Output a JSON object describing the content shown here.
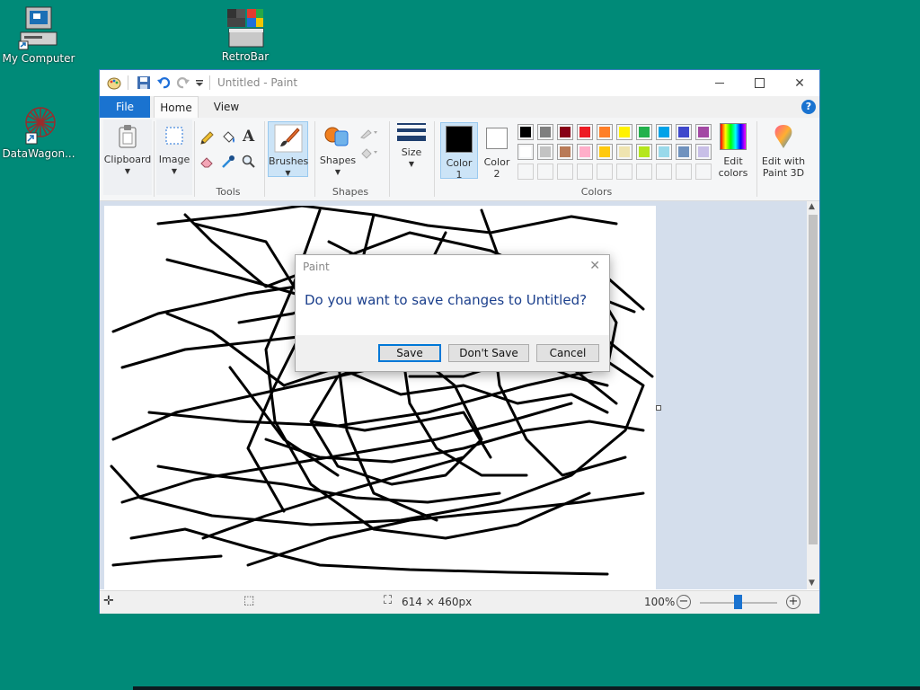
{
  "desktop": {
    "icons": [
      {
        "label": "My Computer"
      },
      {
        "label": "RetroBar"
      },
      {
        "label": "DataWagon..."
      }
    ]
  },
  "window": {
    "title": "Untitled - Paint",
    "tabs": {
      "file": "File",
      "home": "Home",
      "view": "View"
    },
    "help": "?",
    "ribbon": {
      "clipboard": "Clipboard",
      "image": "Image",
      "tools_label": "Tools",
      "brushes": "Brushes",
      "shapes": "Shapes",
      "shapes_label": "Shapes",
      "size": "Size",
      "color1_line1": "Color",
      "color1_line2": "1",
      "color2_line1": "Color",
      "color2_line2": "2",
      "colors_label": "Colors",
      "edit_colors_line1": "Edit",
      "edit_colors_line2": "colors",
      "paint3d_line1": "Edit with",
      "paint3d_line2": "Paint 3D"
    },
    "palette_row1": [
      "#000000",
      "#7f7f7f",
      "#880015",
      "#ed1c24",
      "#ff7f27",
      "#fff200",
      "#22b14c",
      "#00a2e8",
      "#3f48cc",
      "#a349a4"
    ],
    "palette_row2": [
      "#ffffff",
      "#c3c3c3",
      "#b97a57",
      "#ffaec9",
      "#ffc90e",
      "#efe4b0",
      "#b5e61d",
      "#99d9ea",
      "#7092be",
      "#c8bfe7"
    ],
    "status": {
      "dimensions": "614 × 460px",
      "zoom": "100%"
    }
  },
  "dialog": {
    "title": "Paint",
    "message": "Do you want to save changes to Untitled?",
    "save": "Save",
    "dont_save": "Don't Save",
    "cancel": "Cancel"
  }
}
